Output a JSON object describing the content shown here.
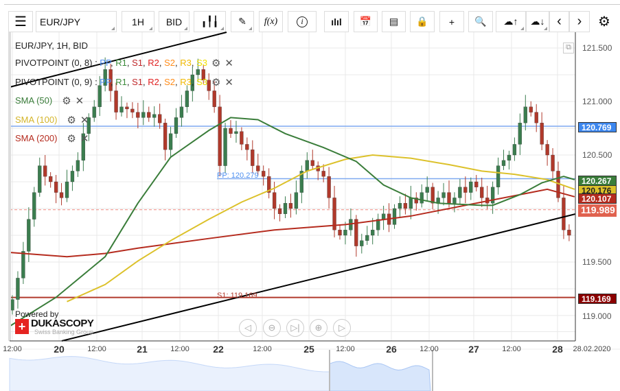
{
  "toolbar": {
    "symbol": "EUR/JPY",
    "timeframe": "1H",
    "side": "BID",
    "fx": "f(x)"
  },
  "legend": {
    "title": "EUR/JPY, 1H, BID",
    "pivot1": "PIVOTPOINT (0, 8)",
    "pivot2": "PIVOTPOINT (0, 9)",
    "pivot_parts": [
      "PP",
      ", ",
      "R1",
      ", ",
      "S1",
      ", ",
      "R2",
      ", ",
      "S2",
      ", ",
      "R3",
      ", ",
      "S3"
    ],
    "sma50": "SMA (50)",
    "sma100": "SMA (100)",
    "sma200": "SMA (200)"
  },
  "colors": {
    "up": "#3b7d4f",
    "down": "#b0392b",
    "pp": "#4a8ef0",
    "sma50": "#3a7d3a",
    "sma100": "#dcc12a",
    "sma200": "#b52b1e"
  },
  "price_axis": [
    "121.500",
    "121.000",
    "120.500",
    "119.500",
    "119.000"
  ],
  "badges": {
    "r_line": "120.769",
    "sma50": "120.267",
    "sma100": "120.176",
    "sma200": "120.107",
    "last": "119.989",
    "s1": "119.169"
  },
  "line_labels": {
    "pp": "PP: 120.279",
    "s1": "S1: 119.169"
  },
  "x_axis": [
    "12:00",
    "20",
    "12:00",
    "21",
    "12:00",
    "22",
    "12:00",
    "25",
    "12:00",
    "26",
    "12:00",
    "27",
    "12:00",
    "28",
    "28.02.2020"
  ],
  "branding": {
    "powered": "Powered by",
    "name": "DUKASCOPY",
    "tag": "Swiss Banking Group"
  },
  "chart_data": {
    "type": "candlestick",
    "symbol": "EUR/JPY",
    "timeframe": "1H",
    "ylim": [
      118.8,
      121.65
    ],
    "closes": [
      119.15,
      119.35,
      119.6,
      119.9,
      120.15,
      120.4,
      120.3,
      120.25,
      120.15,
      120.1,
      120.25,
      120.35,
      120.45,
      120.7,
      120.85,
      120.95,
      121.15,
      121.3,
      121.1,
      120.9,
      120.95,
      120.93,
      120.9,
      120.85,
      120.9,
      120.85,
      120.88,
      120.8,
      120.55,
      120.7,
      120.85,
      120.95,
      121.1,
      121.25,
      121.3,
      121.2,
      121.1,
      120.95,
      120.4,
      120.75,
      120.7,
      120.72,
      120.6,
      120.55,
      120.4,
      120.35,
      120.3,
      120.15,
      120.0,
      119.95,
      120.05,
      120.0,
      120.15,
      120.35,
      120.45,
      120.4,
      120.35,
      120.3,
      120.1,
      119.8,
      119.75,
      119.8,
      119.9,
      119.65,
      119.7,
      119.75,
      119.8,
      119.9,
      119.95,
      119.85,
      120.0,
      120.05,
      120.0,
      120.1,
      120.05,
      120.15,
      120.2,
      120.05,
      120.1,
      120.15,
      120.05,
      120.1,
      120.2,
      120.15,
      120.25,
      120.2,
      120.1,
      120.05,
      120.2,
      120.4,
      120.45,
      120.5,
      120.6,
      120.8,
      120.95,
      120.9,
      120.8,
      120.6,
      120.5,
      120.35,
      120.1,
      119.8,
      119.75,
      119.99
    ],
    "sma50": [
      [
        -1,
        118.9
      ],
      [
        8,
        119.17
      ],
      [
        17,
        119.55
      ],
      [
        23,
        120.05
      ],
      [
        29,
        120.48
      ],
      [
        36,
        120.73
      ],
      [
        40,
        120.85
      ],
      [
        45,
        120.83
      ],
      [
        50,
        120.7
      ],
      [
        57,
        120.57
      ],
      [
        63,
        120.44
      ],
      [
        68,
        120.22
      ],
      [
        73,
        120.1
      ],
      [
        78,
        120.05
      ],
      [
        86,
        120.03
      ],
      [
        88,
        120.03
      ],
      [
        93,
        120.13
      ],
      [
        97,
        120.24
      ],
      [
        101,
        120.3
      ],
      [
        103,
        120.27
      ]
    ],
    "sma100": [
      [
        10,
        119.13
      ],
      [
        17,
        119.29
      ],
      [
        23,
        119.51
      ],
      [
        29,
        119.7
      ],
      [
        36,
        119.9
      ],
      [
        42,
        120.06
      ],
      [
        48,
        120.19
      ],
      [
        54,
        120.35
      ],
      [
        61,
        120.46
      ],
      [
        66,
        120.5
      ],
      [
        73,
        120.47
      ],
      [
        80,
        120.41
      ],
      [
        86,
        120.35
      ],
      [
        92,
        120.32
      ],
      [
        98,
        120.27
      ],
      [
        103,
        120.18
      ]
    ],
    "sma200": [
      [
        -1,
        119.59
      ],
      [
        10,
        119.55
      ],
      [
        17,
        119.58
      ],
      [
        23,
        119.63
      ],
      [
        36,
        119.72
      ],
      [
        48,
        119.8
      ],
      [
        61,
        119.85
      ],
      [
        73,
        119.93
      ],
      [
        86,
        120.06
      ],
      [
        98,
        120.18
      ],
      [
        103,
        120.11
      ]
    ],
    "levels": {
      "r": 120.769,
      "pp": 120.279,
      "last": 119.989,
      "s1": 119.169
    }
  }
}
